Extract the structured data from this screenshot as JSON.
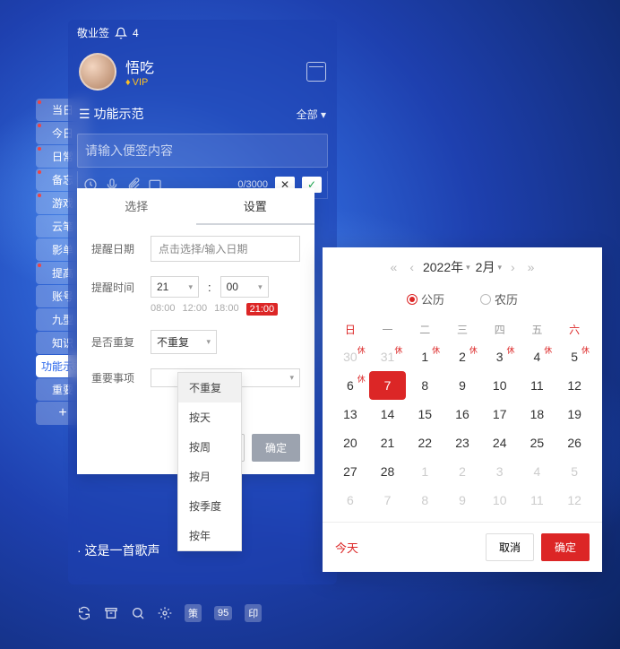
{
  "app": {
    "title": "敬业签",
    "notif_count": "4"
  },
  "user": {
    "name": "悟吃",
    "vip": "VIP"
  },
  "side_tabs": [
    "当日",
    "今日",
    "日常",
    "备忘",
    "游戏",
    "云笔",
    "影单",
    "提高",
    "账号",
    "九型",
    "知识",
    "功能示范",
    "重要"
  ],
  "side_active_index": 11,
  "section": {
    "title": "功能示范",
    "all": "全部",
    "placeholder": "请输入便签内容",
    "counter": "0/3000"
  },
  "settings": {
    "tabs": [
      "选择",
      "设置"
    ],
    "active_tab": 1,
    "date_label": "提醒日期",
    "date_placeholder": "点击选择/输入日期",
    "time_label": "提醒时间",
    "hour": "21",
    "minute": "00",
    "presets": [
      "08:00",
      "12:00",
      "18:00",
      "21:00"
    ],
    "preset_active": 3,
    "repeat_label": "是否重复",
    "repeat_value": "不重复",
    "important_label": "重要事项",
    "cancel": "取消",
    "confirm": "确定"
  },
  "repeat_options": [
    "不重复",
    "按天",
    "按周",
    "按月",
    "按季度",
    "按年"
  ],
  "song": "· 这是一首歌声",
  "bottom_badges": [
    "策",
    "95",
    "印"
  ],
  "calendar": {
    "year": "2022年",
    "month": "2月",
    "type_solar": "公历",
    "type_lunar": "农历",
    "dow": [
      "日",
      "一",
      "二",
      "三",
      "四",
      "五",
      "六"
    ],
    "today_link": "今天",
    "cancel": "取消",
    "confirm": "确定",
    "holiday_mark": "休",
    "weeks": [
      [
        {
          "d": "30",
          "dim": true,
          "off": true
        },
        {
          "d": "31",
          "dim": true,
          "off": true
        },
        {
          "d": "1",
          "off": true
        },
        {
          "d": "2",
          "off": true
        },
        {
          "d": "3",
          "off": true
        },
        {
          "d": "4",
          "off": true
        },
        {
          "d": "5",
          "off": true
        }
      ],
      [
        {
          "d": "6",
          "off": true
        },
        {
          "d": "7",
          "today": true
        },
        {
          "d": "8"
        },
        {
          "d": "9"
        },
        {
          "d": "10"
        },
        {
          "d": "11"
        },
        {
          "d": "12"
        }
      ],
      [
        {
          "d": "13"
        },
        {
          "d": "14"
        },
        {
          "d": "15"
        },
        {
          "d": "16"
        },
        {
          "d": "17"
        },
        {
          "d": "18"
        },
        {
          "d": "19"
        }
      ],
      [
        {
          "d": "20"
        },
        {
          "d": "21"
        },
        {
          "d": "22"
        },
        {
          "d": "23"
        },
        {
          "d": "24"
        },
        {
          "d": "25"
        },
        {
          "d": "26"
        }
      ],
      [
        {
          "d": "27"
        },
        {
          "d": "28"
        },
        {
          "d": "1",
          "dim": true
        },
        {
          "d": "2",
          "dim": true
        },
        {
          "d": "3",
          "dim": true
        },
        {
          "d": "4",
          "dim": true
        },
        {
          "d": "5",
          "dim": true
        }
      ],
      [
        {
          "d": "6",
          "dim": true
        },
        {
          "d": "7",
          "dim": true
        },
        {
          "d": "8",
          "dim": true
        },
        {
          "d": "9",
          "dim": true
        },
        {
          "d": "10",
          "dim": true
        },
        {
          "d": "11",
          "dim": true
        },
        {
          "d": "12",
          "dim": true
        }
      ]
    ]
  }
}
